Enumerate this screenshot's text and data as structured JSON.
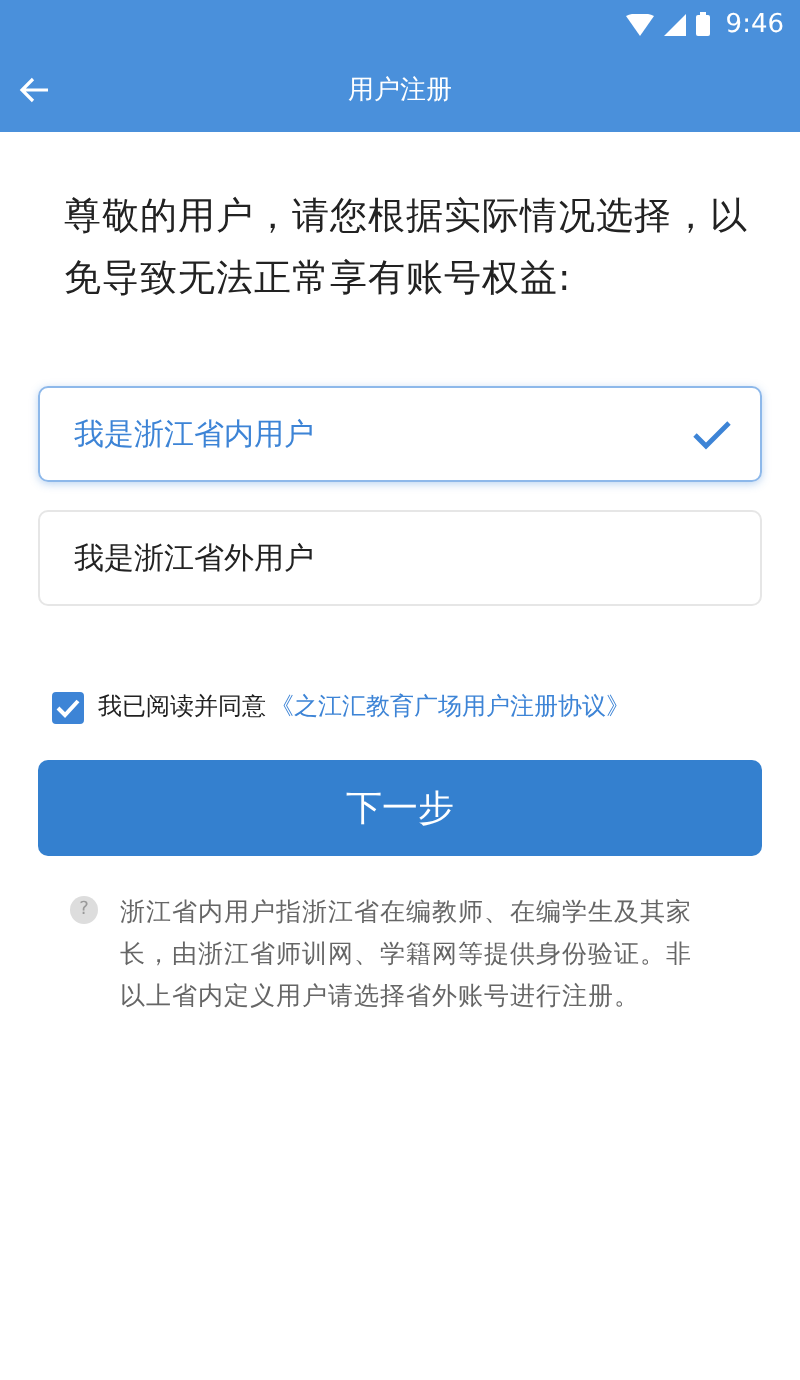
{
  "status_bar": {
    "time": "9:46"
  },
  "app_bar": {
    "title": "用户注册"
  },
  "prompt": "尊敬的用户，请您根据实际情况选择，以免导致无法正常享有账号权益:",
  "options": [
    {
      "label": "我是浙江省内用户",
      "selected": true
    },
    {
      "label": "我是浙江省外用户",
      "selected": false
    }
  ],
  "agreement": {
    "checked": true,
    "text": "我已阅读并同意",
    "link": "《之江汇教育广场用户注册协议》"
  },
  "next_button": "下一步",
  "note": {
    "icon": "?",
    "text": "浙江省内用户指浙江省在编教师、在编学生及其家长，由浙江省师训网、学籍网等提供身份验证。非以上省内定义用户请选择省外账号进行注册。"
  }
}
